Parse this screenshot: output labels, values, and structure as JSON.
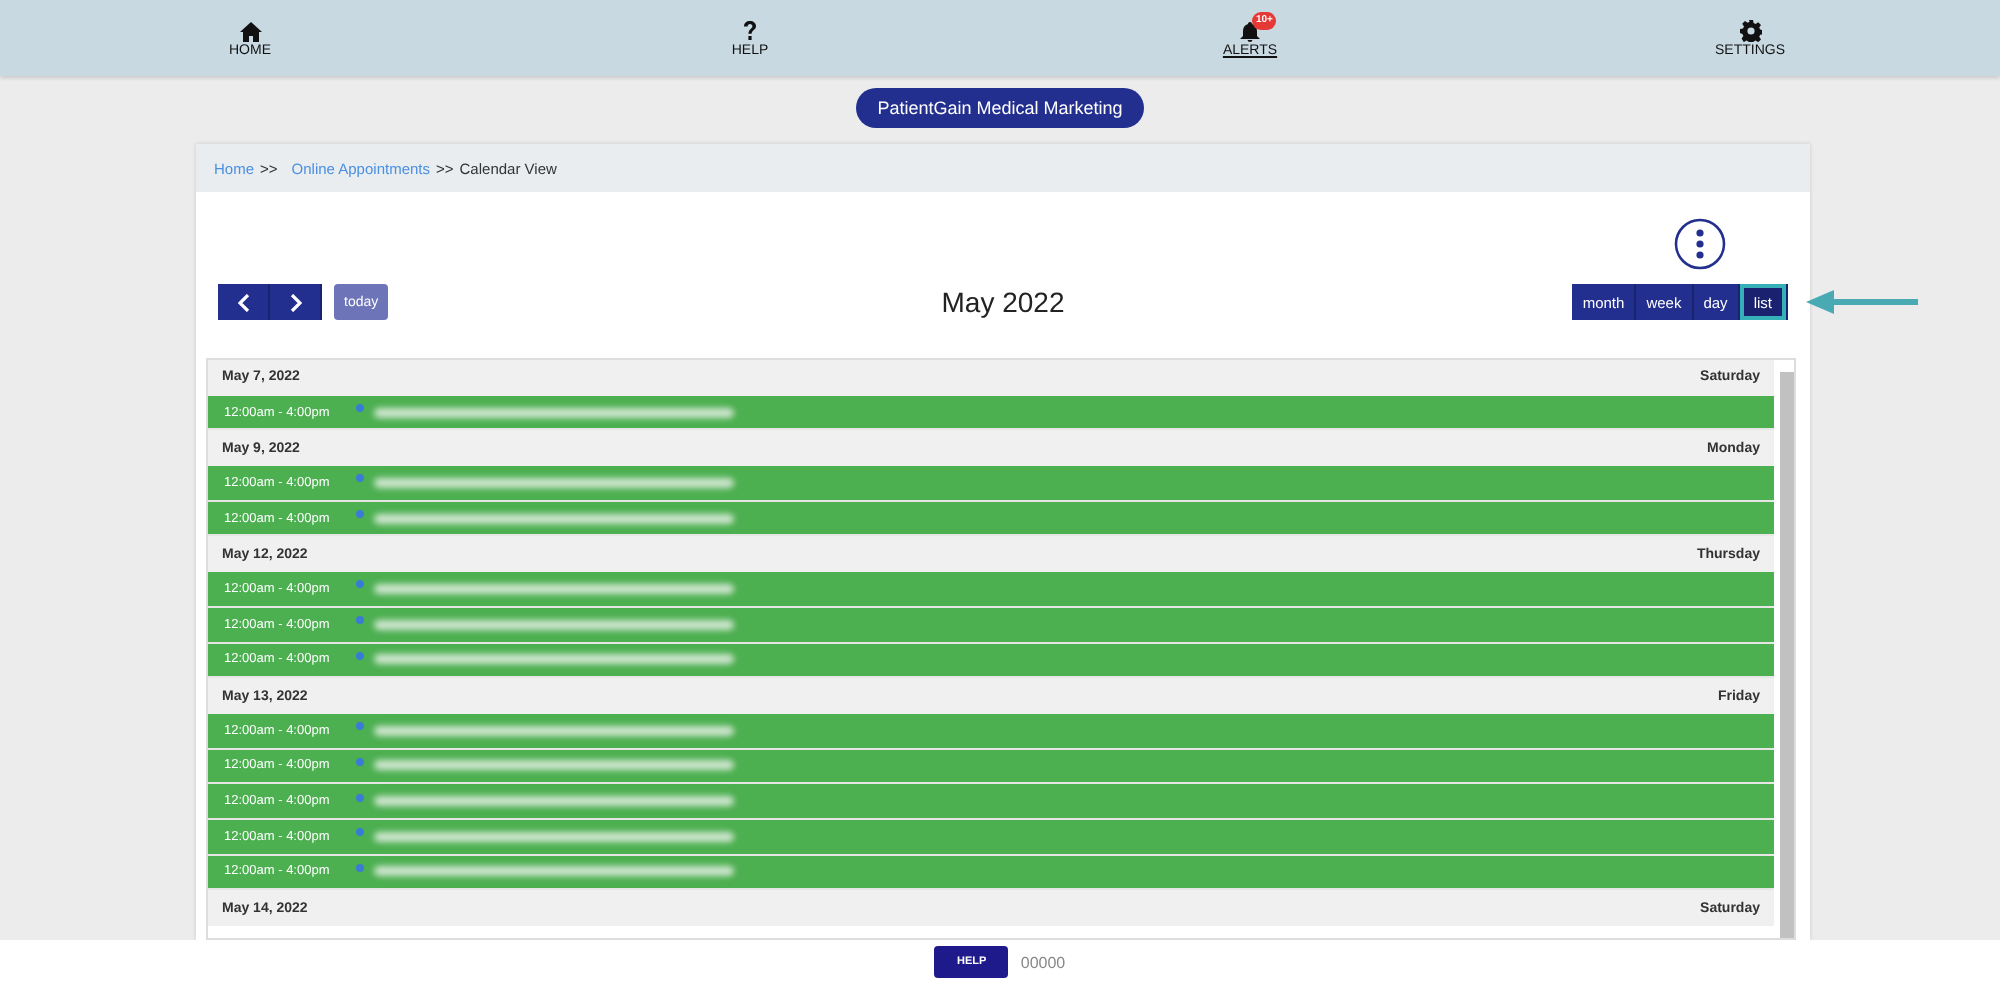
{
  "nav": [
    {
      "label": "HOME",
      "selected": false
    },
    {
      "label": "HELP",
      "selected": false
    },
    {
      "label": "ALERTS",
      "selected": true,
      "badge": "10+"
    },
    {
      "label": "SETTINGS",
      "selected": false
    }
  ],
  "company": "PatientGain Medical Marketing",
  "breadcrumb": [
    {
      "label": "Home",
      "link": true
    },
    {
      "label": ">>",
      "link": false
    },
    {
      "label": "Online Appointments",
      "link": true
    },
    {
      "label": ">>",
      "link": false
    },
    {
      "label": "Calendar View",
      "link": false
    }
  ],
  "toolbar": {
    "today": "today",
    "title": "May 2022",
    "views": [
      {
        "label": "month",
        "selected": false
      },
      {
        "label": "week",
        "selected": false
      },
      {
        "label": "day",
        "selected": false
      },
      {
        "label": "list",
        "selected": true
      }
    ]
  },
  "days": [
    {
      "date": "May 7, 2022",
      "weekday": "Saturday",
      "events": [
        {
          "time": "12:00am - 4:00pm"
        }
      ]
    },
    {
      "date": "May 9, 2022",
      "weekday": "Monday",
      "events": [
        {
          "time": "12:00am - 4:00pm"
        },
        {
          "time": "12:00am - 4:00pm"
        }
      ]
    },
    {
      "date": "May 12, 2022",
      "weekday": "Thursday",
      "events": [
        {
          "time": "12:00am - 4:00pm"
        },
        {
          "time": "12:00am - 4:00pm"
        },
        {
          "time": "12:00am - 4:00pm"
        }
      ]
    },
    {
      "date": "May 13, 2022",
      "weekday": "Friday",
      "events": [
        {
          "time": "12:00am - 4:00pm"
        },
        {
          "time": "12:00am - 4:00pm"
        },
        {
          "time": "12:00am - 4:00pm"
        },
        {
          "time": "12:00am - 4:00pm"
        },
        {
          "time": "12:00am - 4:00pm"
        }
      ]
    },
    {
      "date": "May 14, 2022",
      "weekday": "Saturday"
    }
  ],
  "footer": {
    "button": "HELP",
    "code": "00000"
  }
}
